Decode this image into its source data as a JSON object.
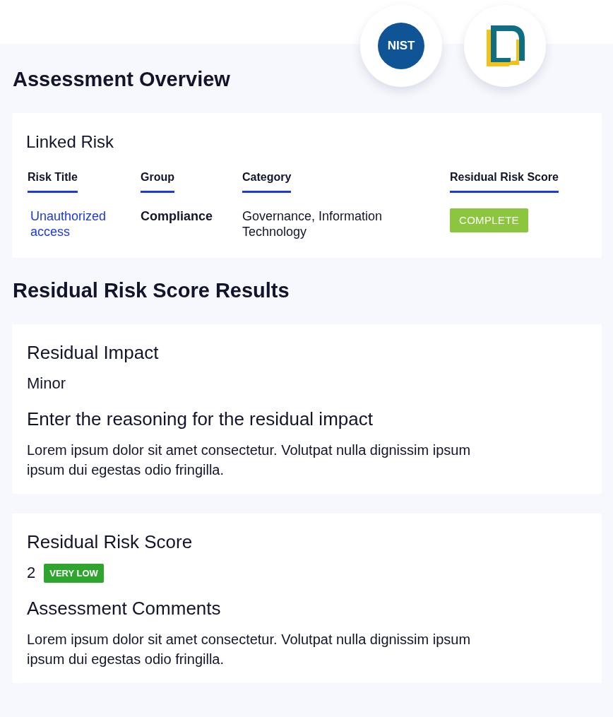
{
  "logos": [
    {
      "kind": "nist",
      "text": "NIST"
    },
    {
      "kind": "frame"
    }
  ],
  "title": "Assessment Overview",
  "linked_risk": {
    "title": "Linked Risk",
    "columns": [
      "Risk Title",
      "Group",
      "Category",
      "Residual Risk Score"
    ],
    "row": {
      "risk_title": "Unauthorized access",
      "group": "Compliance",
      "category": "Governance, Information Technology",
      "status": "COMPLETE"
    }
  },
  "results_title": "Residual Risk Score Results",
  "cards": [
    {
      "heading": "Residual Impact",
      "value": "Minor",
      "subheading": "Enter the reasoning for the residual impact",
      "text": "Lorem ipsum dolor sit amet consectetur. Volutpat nulla dignissim ipsum ipsum dui egestas odio fringilla."
    },
    {
      "heading": "Residual Risk Score",
      "value": "2",
      "badge": "VERY LOW",
      "subheading": "Assessment Comments",
      "text": "Lorem ipsum dolor sit amet consectetur. Volutpat nulla dignissim ipsum ipsum dui egestas odio fringilla."
    }
  ]
}
